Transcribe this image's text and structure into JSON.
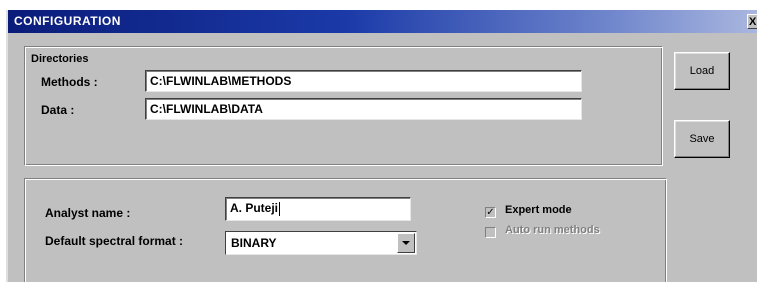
{
  "window": {
    "title": "CONFIGURATION",
    "close_glyph": "X"
  },
  "directories": {
    "group_label": "Directories",
    "methods_label": "Methods :",
    "methods_value": "C:\\FLWINLAB\\METHODS",
    "data_label": "Data :",
    "data_value": "C:\\FLWINLAB\\DATA"
  },
  "buttons": {
    "load_label": "Load",
    "save_label": "Save"
  },
  "analyst": {
    "name_label": "Analyst name :",
    "name_value": "A. Puteji",
    "format_label": "Default spectral format :",
    "format_value": "BINARY",
    "expert_mode_label": "Expert mode",
    "expert_mode_checked": true,
    "auto_run_label": "Auto run methods",
    "auto_run_checked": false,
    "auto_run_enabled": false
  },
  "icons": {
    "close": "close-icon",
    "dropdown": "chevron-down-icon",
    "checkmark": "check-icon"
  }
}
